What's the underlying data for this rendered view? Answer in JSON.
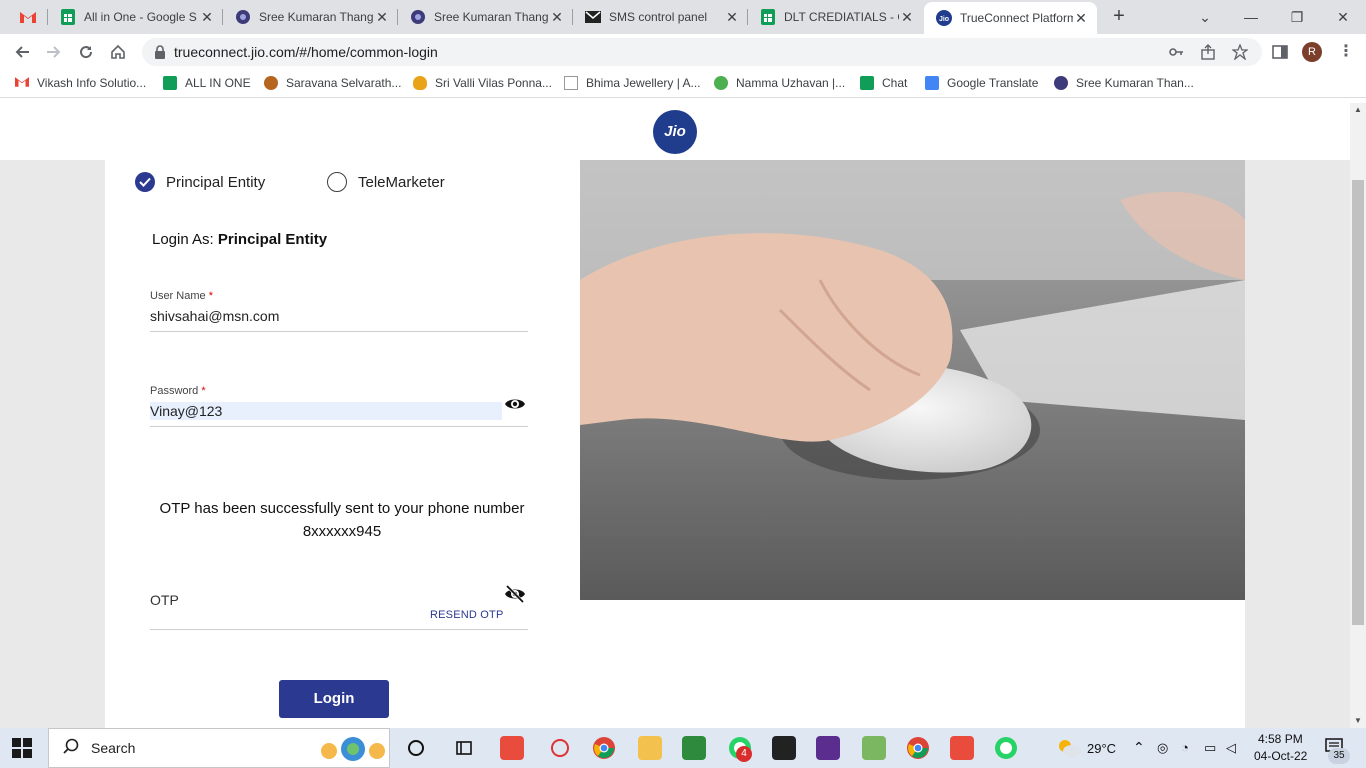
{
  "browser": {
    "tabs": [
      {
        "title": "",
        "icon": "gmail-icon",
        "active": false
      },
      {
        "title": "All in One - Google S",
        "icon": "sheets-icon",
        "active": false
      },
      {
        "title": "Sree Kumaran Thang",
        "icon": "site-globe-icon",
        "active": false
      },
      {
        "title": "Sree Kumaran Thang",
        "icon": "site-globe-icon",
        "active": false
      },
      {
        "title": "SMS control panel",
        "icon": "mail-icon",
        "active": false
      },
      {
        "title": "DLT CREDIATIALS - G",
        "icon": "sheets-icon",
        "active": false
      },
      {
        "title": "TrueConnect Platform",
        "icon": "jio-icon",
        "active": true
      }
    ],
    "url": "trueconnect.jio.com/#/home/common-login",
    "profile_initial": "R",
    "bookmarks": [
      {
        "label": "Vikash Info Solutio...",
        "icon": "gmail-icon"
      },
      {
        "label": "ALL IN ONE",
        "icon": "sheets-icon"
      },
      {
        "label": "Saravana Selvarath...",
        "icon": "store-icon"
      },
      {
        "label": "Sri Valli Vilas Ponna...",
        "icon": "flame-icon"
      },
      {
        "label": "Bhima Jewellery | A...",
        "icon": "jewel-icon"
      },
      {
        "label": "Namma Uzhavan |...",
        "icon": "farm-icon"
      },
      {
        "label": "Chat",
        "icon": "chat-icon"
      },
      {
        "label": "Google Translate",
        "icon": "translate-icon"
      },
      {
        "label": "Sree Kumaran Than...",
        "icon": "site-globe-icon"
      }
    ]
  },
  "page": {
    "logo_text": "Jio",
    "entity_options": [
      {
        "label": "Principal Entity",
        "selected": true
      },
      {
        "label": "TeleMarketer",
        "selected": false
      }
    ],
    "login_as_prefix": "Login As:",
    "login_as_value": "Principal Entity",
    "username": {
      "label": "User Name",
      "required_mark": "*",
      "value": "shivsahai@msn.com"
    },
    "password": {
      "label": "Password",
      "required_mark": "*",
      "value": "Vinay@123"
    },
    "otp_message_line1": "OTP has been successfully sent to your phone number",
    "otp_message_line2": "8xxxxxx945",
    "otp": {
      "placeholder": "OTP",
      "value": ""
    },
    "resend_label": "RESEND OTP",
    "login_button": "Login",
    "accent_color": "#2b3990"
  },
  "taskbar": {
    "search_label": "Search",
    "weather": "29°C",
    "time": "4:58 PM",
    "date": "04-Oct-22",
    "whatsapp_badge": "4",
    "notification_count": "35"
  }
}
